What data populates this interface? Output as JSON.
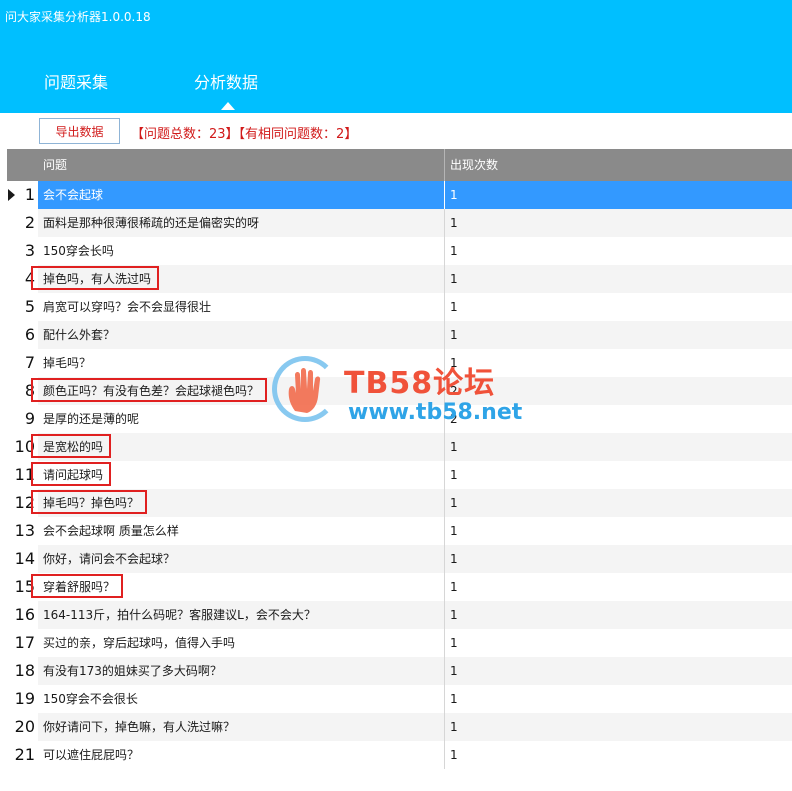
{
  "app": {
    "title": "问大家采集分析器1.0.0.18"
  },
  "tabs": [
    {
      "label": "问题采集",
      "active": false
    },
    {
      "label": "分析数据",
      "active": true
    }
  ],
  "toolbar": {
    "export_label": "导出数据",
    "stats": "【问题总数：23】【有相同问题数：2】"
  },
  "table": {
    "columns": [
      "问题",
      "出现次数"
    ],
    "rows": [
      {
        "index": "1",
        "question": "会不会起球",
        "count": "1"
      },
      {
        "index": "2",
        "question": "面料是那种很薄很稀疏的还是偏密实的呀",
        "count": "1"
      },
      {
        "index": "3",
        "question": "150穿会长吗",
        "count": "1"
      },
      {
        "index": "4",
        "question": "掉色吗，有人洗过吗",
        "count": "1"
      },
      {
        "index": "5",
        "question": "肩宽可以穿吗？会不会显得很壮",
        "count": "1"
      },
      {
        "index": "6",
        "question": "配什么外套？",
        "count": "1"
      },
      {
        "index": "7",
        "question": "掉毛吗？",
        "count": "1"
      },
      {
        "index": "8",
        "question": "颜色正吗？有没有色差？会起球褪色吗？",
        "count": "2"
      },
      {
        "index": "9",
        "question": "是厚的还是薄的呢",
        "count": "2"
      },
      {
        "index": "10",
        "question": "是宽松的吗",
        "count": "1"
      },
      {
        "index": "11",
        "question": "请问起球吗",
        "count": "1"
      },
      {
        "index": "12",
        "question": "掉毛吗？掉色吗？",
        "count": "1"
      },
      {
        "index": "13",
        "question": "会不会起球啊 质量怎么样",
        "count": "1"
      },
      {
        "index": "14",
        "question": "你好，请问会不会起球？",
        "count": "1"
      },
      {
        "index": "15",
        "question": "穿着舒服吗？",
        "count": "1"
      },
      {
        "index": "16",
        "question": "164-113斤，拍什么码呢？客服建议L，会不会大？",
        "count": "1"
      },
      {
        "index": "17",
        "question": "买过的亲，穿后起球吗，值得入手吗",
        "count": "1"
      },
      {
        "index": "18",
        "question": "有没有173的姐妹买了多大码啊？",
        "count": "1"
      },
      {
        "index": "19",
        "question": "150穿会不会很长",
        "count": "1"
      },
      {
        "index": "20",
        "question": "你好请问下，掉色嘛，有人洗过嘛？",
        "count": "1"
      },
      {
        "index": "21",
        "question": "可以遮住屁屁吗？",
        "count": "1"
      }
    ]
  },
  "highlighted_rows": [
    "4",
    "8",
    "10",
    "11",
    "12",
    "15"
  ],
  "watermark": {
    "title": "TB58论坛",
    "url": "www.tb58.net"
  },
  "colors": {
    "header": "#00bfff",
    "selected_row": "#3399ff",
    "accent_red": "#d11a1a",
    "grid_header": "#8a8a8a"
  }
}
